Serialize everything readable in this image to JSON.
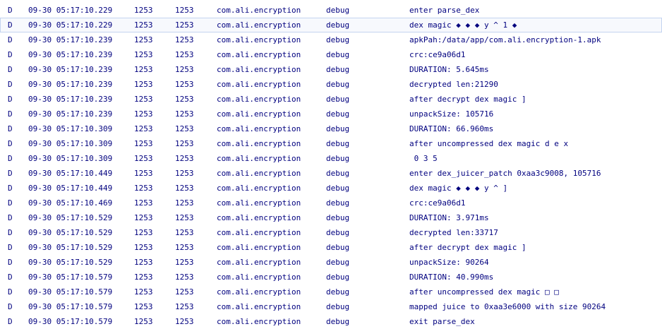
{
  "log": {
    "selected_index": 1,
    "rows": [
      {
        "level": "D",
        "time": "09-30 05:17:10.229",
        "pid": "1253",
        "tid": "1253",
        "app": "com.ali.encryption",
        "tag": "debug",
        "text": "enter parse_dex"
      },
      {
        "level": "D",
        "time": "09-30 05:17:10.229",
        "pid": "1253",
        "tid": "1253",
        "app": "com.ali.encryption",
        "tag": "debug",
        "text": "dex magic ◆ ◆ ◆ y ^ 1 ◆"
      },
      {
        "level": "D",
        "time": "09-30 05:17:10.239",
        "pid": "1253",
        "tid": "1253",
        "app": "com.ali.encryption",
        "tag": "debug",
        "text": "apkPah:/data/app/com.ali.encryption-1.apk"
      },
      {
        "level": "D",
        "time": "09-30 05:17:10.239",
        "pid": "1253",
        "tid": "1253",
        "app": "com.ali.encryption",
        "tag": "debug",
        "text": "crc:ce9a06d1"
      },
      {
        "level": "D",
        "time": "09-30 05:17:10.239",
        "pid": "1253",
        "tid": "1253",
        "app": "com.ali.encryption",
        "tag": "debug",
        "text": "DURATION: 5.645ms"
      },
      {
        "level": "D",
        "time": "09-30 05:17:10.239",
        "pid": "1253",
        "tid": "1253",
        "app": "com.ali.encryption",
        "tag": "debug",
        "text": "decrypted len:21290"
      },
      {
        "level": "D",
        "time": "09-30 05:17:10.239",
        "pid": "1253",
        "tid": "1253",
        "app": "com.ali.encryption",
        "tag": "debug",
        "text": "after decrypt dex magic ]"
      },
      {
        "level": "D",
        "time": "09-30 05:17:10.239",
        "pid": "1253",
        "tid": "1253",
        "app": "com.ali.encryption",
        "tag": "debug",
        "text": "unpackSize: 105716"
      },
      {
        "level": "D",
        "time": "09-30 05:17:10.309",
        "pid": "1253",
        "tid": "1253",
        "app": "com.ali.encryption",
        "tag": "debug",
        "text": "DURATION: 66.960ms"
      },
      {
        "level": "D",
        "time": "09-30 05:17:10.309",
        "pid": "1253",
        "tid": "1253",
        "app": "com.ali.encryption",
        "tag": "debug",
        "text": "after uncompressed dex magic d e x"
      },
      {
        "level": "D",
        "time": "09-30 05:17:10.309",
        "pid": "1253",
        "tid": "1253",
        "app": "com.ali.encryption",
        "tag": "debug",
        "text": " 0 3 5"
      },
      {
        "level": "D",
        "time": "09-30 05:17:10.449",
        "pid": "1253",
        "tid": "1253",
        "app": "com.ali.encryption",
        "tag": "debug",
        "text": "enter dex_juicer_patch 0xaa3c9008, 105716"
      },
      {
        "level": "D",
        "time": "09-30 05:17:10.449",
        "pid": "1253",
        "tid": "1253",
        "app": "com.ali.encryption",
        "tag": "debug",
        "text": "dex magic ◆ ◆ ◆ y ^ ]"
      },
      {
        "level": "D",
        "time": "09-30 05:17:10.469",
        "pid": "1253",
        "tid": "1253",
        "app": "com.ali.encryption",
        "tag": "debug",
        "text": "crc:ce9a06d1"
      },
      {
        "level": "D",
        "time": "09-30 05:17:10.529",
        "pid": "1253",
        "tid": "1253",
        "app": "com.ali.encryption",
        "tag": "debug",
        "text": "DURATION: 3.971ms"
      },
      {
        "level": "D",
        "time": "09-30 05:17:10.529",
        "pid": "1253",
        "tid": "1253",
        "app": "com.ali.encryption",
        "tag": "debug",
        "text": "decrypted len:33717"
      },
      {
        "level": "D",
        "time": "09-30 05:17:10.529",
        "pid": "1253",
        "tid": "1253",
        "app": "com.ali.encryption",
        "tag": "debug",
        "text": "after decrypt dex magic ]"
      },
      {
        "level": "D",
        "time": "09-30 05:17:10.529",
        "pid": "1253",
        "tid": "1253",
        "app": "com.ali.encryption",
        "tag": "debug",
        "text": "unpackSize: 90264"
      },
      {
        "level": "D",
        "time": "09-30 05:17:10.579",
        "pid": "1253",
        "tid": "1253",
        "app": "com.ali.encryption",
        "tag": "debug",
        "text": "DURATION: 40.990ms"
      },
      {
        "level": "D",
        "time": "09-30 05:17:10.579",
        "pid": "1253",
        "tid": "1253",
        "app": "com.ali.encryption",
        "tag": "debug",
        "text": "after uncompressed dex magic □ □"
      },
      {
        "level": "D",
        "time": "09-30 05:17:10.579",
        "pid": "1253",
        "tid": "1253",
        "app": "com.ali.encryption",
        "tag": "debug",
        "text": "mapped juice to 0xaa3e6000 with size 90264"
      },
      {
        "level": "D",
        "time": "09-30 05:17:10.579",
        "pid": "1253",
        "tid": "1253",
        "app": "com.ali.encryption",
        "tag": "debug",
        "text": "exit parse_dex"
      }
    ]
  },
  "colors": {
    "text": "#00007f",
    "background": "#ffffff",
    "selected_border": "#c4d4f0"
  }
}
